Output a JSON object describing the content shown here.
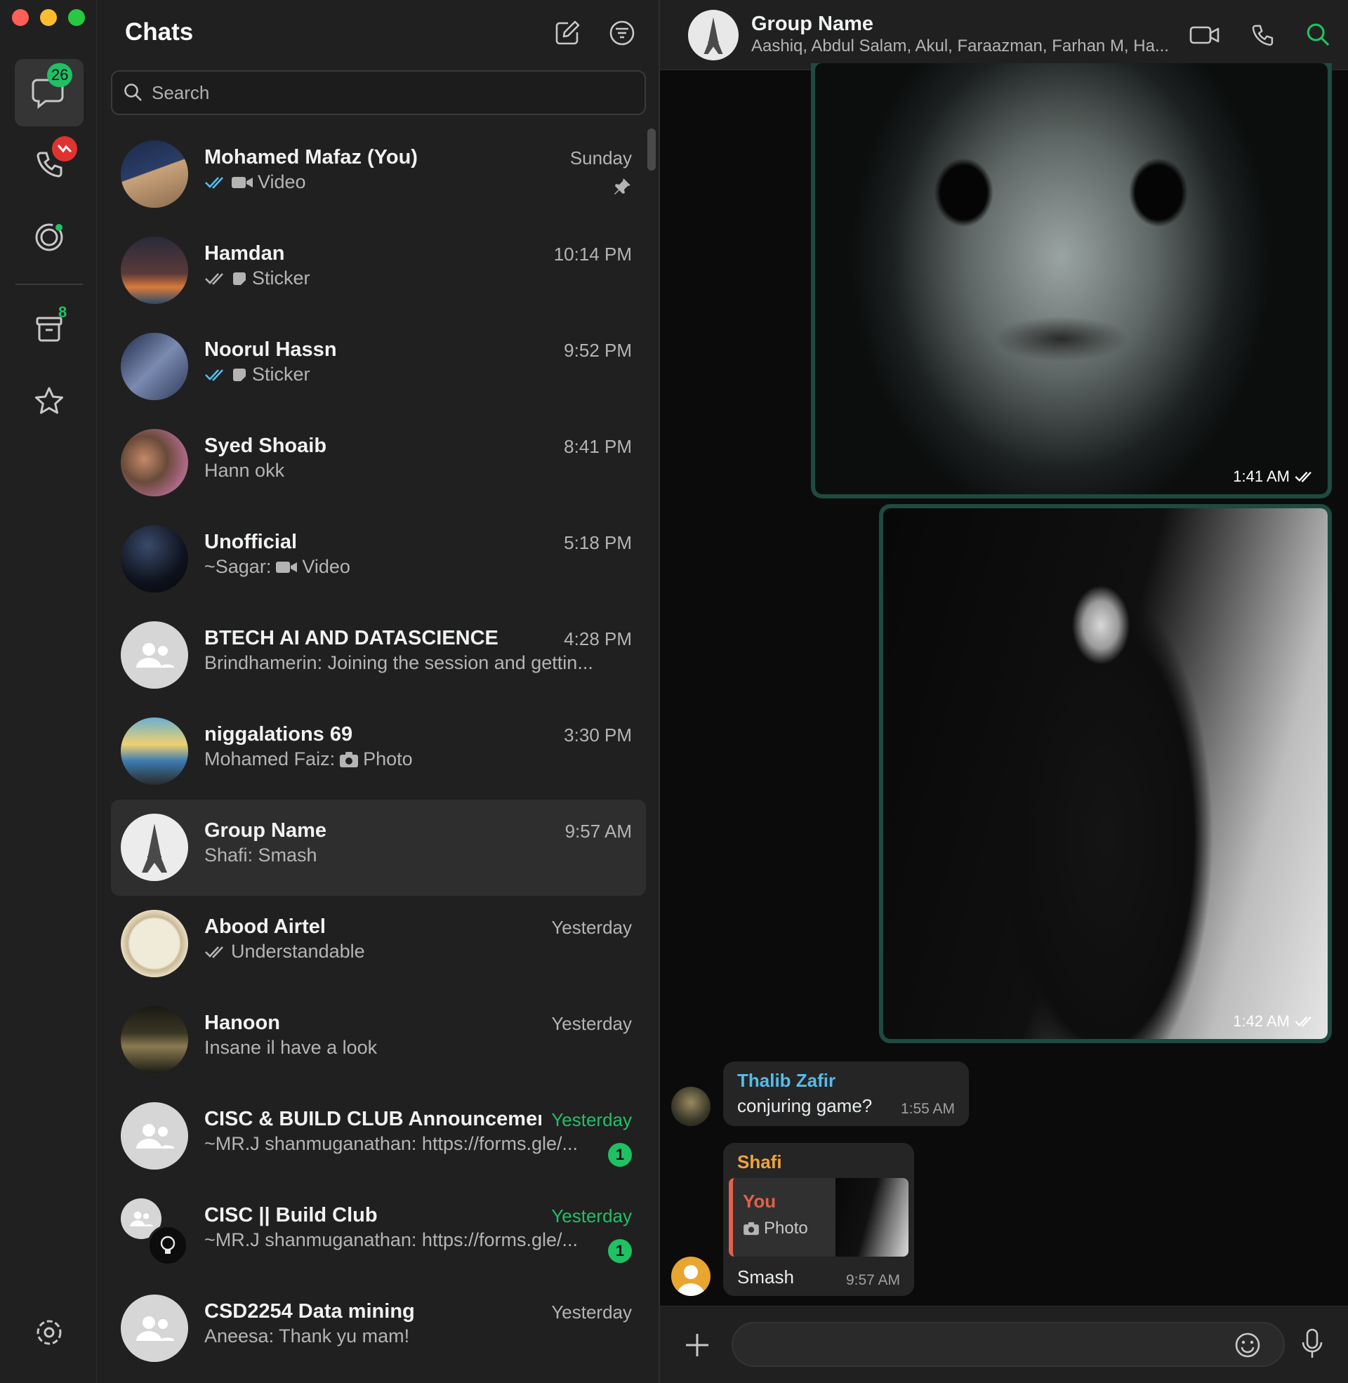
{
  "window": {
    "controls": [
      "close",
      "minimize",
      "zoom"
    ]
  },
  "rail": {
    "chats_badge": "26",
    "archive_badge": "8",
    "icons": [
      "chats-icon",
      "calls-icon",
      "status-icon",
      "archive-icon",
      "starred-icon",
      "settings-icon"
    ]
  },
  "list": {
    "title": "Chats",
    "search_placeholder": "Search",
    "chats": [
      {
        "name": "Mohamed Mafaz (You)",
        "time": "Sunday",
        "preview": "Video",
        "tick": "read",
        "media": "video",
        "pinned": true
      },
      {
        "name": "Hamdan",
        "time": "10:14 PM",
        "preview": "Sticker",
        "tick": "delivered",
        "media": "sticker"
      },
      {
        "name": "Noorul Hassn",
        "time": "9:52 PM",
        "preview": "Sticker",
        "tick": "read",
        "media": "sticker"
      },
      {
        "name": "Syed Shoaib",
        "time": "8:41 PM",
        "preview": "Hann okk"
      },
      {
        "name": "Unofficial",
        "time": "5:18 PM",
        "preview_prefix": "~Sagar:",
        "preview": "Video",
        "media": "video"
      },
      {
        "name": "BTECH AI AND DATASCIENCE",
        "time": "4:28 PM",
        "preview": "Brindhamerin: Joining the session and gettin..."
      },
      {
        "name": "niggalations 69",
        "time": "3:30 PM",
        "preview_prefix": "Mohamed Faiz:",
        "preview": "Photo",
        "media": "photo"
      },
      {
        "name": "Group Name",
        "time": "9:57 AM",
        "preview": "Shafi: Smash"
      },
      {
        "name": "Abood Airtel",
        "time": "Yesterday",
        "preview": "Understandable",
        "tick": "delivered"
      },
      {
        "name": "Hanoon",
        "time": "Yesterday",
        "preview": "Insane il have a look"
      },
      {
        "name": "CISC & BUILD CLUB Announcement",
        "time": "Yesterday",
        "preview": "~MR.J shanmuganathan: https://forms.gle/...",
        "unread": "1"
      },
      {
        "name": "CISC || Build  Club",
        "time": "Yesterday",
        "preview": "~MR.J shanmuganathan: https://forms.gle/...",
        "unread": "1"
      },
      {
        "name": "CSD2254 Data mining",
        "time": "Yesterday",
        "preview": "Aneesa: Thank yu mam!"
      }
    ]
  },
  "conversation": {
    "title": "Group Name",
    "participants": "Aashiq, Abdul Salam, Akul, Faraazman, Farhan M, Ha...",
    "messages": [
      {
        "type": "image",
        "time": "1:41 AM"
      },
      {
        "type": "image",
        "time": "1:42 AM"
      },
      {
        "type": "text",
        "sender": "Thalib Zafir",
        "text": "conjuring game?",
        "time": "1:55 AM"
      },
      {
        "type": "reply",
        "sender": "Shafi",
        "quoted_sender": "You",
        "quoted_text": "Photo",
        "text": "Smash",
        "time": "9:57 AM"
      }
    ],
    "composer_placeholder": ""
  },
  "colors": {
    "accent": "#21c063",
    "sender_thalib": "#53bdeb",
    "sender_shafi": "#f0a43a",
    "quote_you": "#e4604a",
    "outgoing_border": "#1f4a3f"
  }
}
